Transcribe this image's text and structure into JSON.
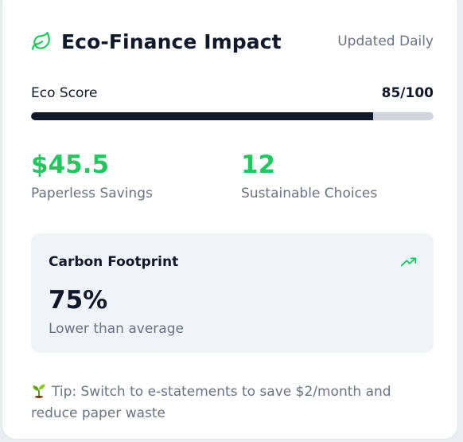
{
  "header": {
    "title": "Eco-Finance Impact",
    "updated": "Updated Daily",
    "icon": "leaf-icon"
  },
  "score": {
    "label": "Eco Score",
    "value_text": "85/100",
    "value": 85,
    "max": 100
  },
  "stats": [
    {
      "value": "$45.5",
      "label": "Paperless Savings"
    },
    {
      "value": "12",
      "label": "Sustainable Choices"
    }
  ],
  "carbon": {
    "title": "Carbon Footprint",
    "value": "75%",
    "subtitle": "Lower than average",
    "icon": "trending-up-icon"
  },
  "tip": {
    "icon": "seedling-icon",
    "text": "Tip: Switch to e-statements to save $2/month and reduce paper waste"
  },
  "colors": {
    "accent": "#22c55e",
    "dark": "#111827",
    "muted": "#6b7280",
    "track": "#d1d5db",
    "panel": "#f0f3f8"
  }
}
